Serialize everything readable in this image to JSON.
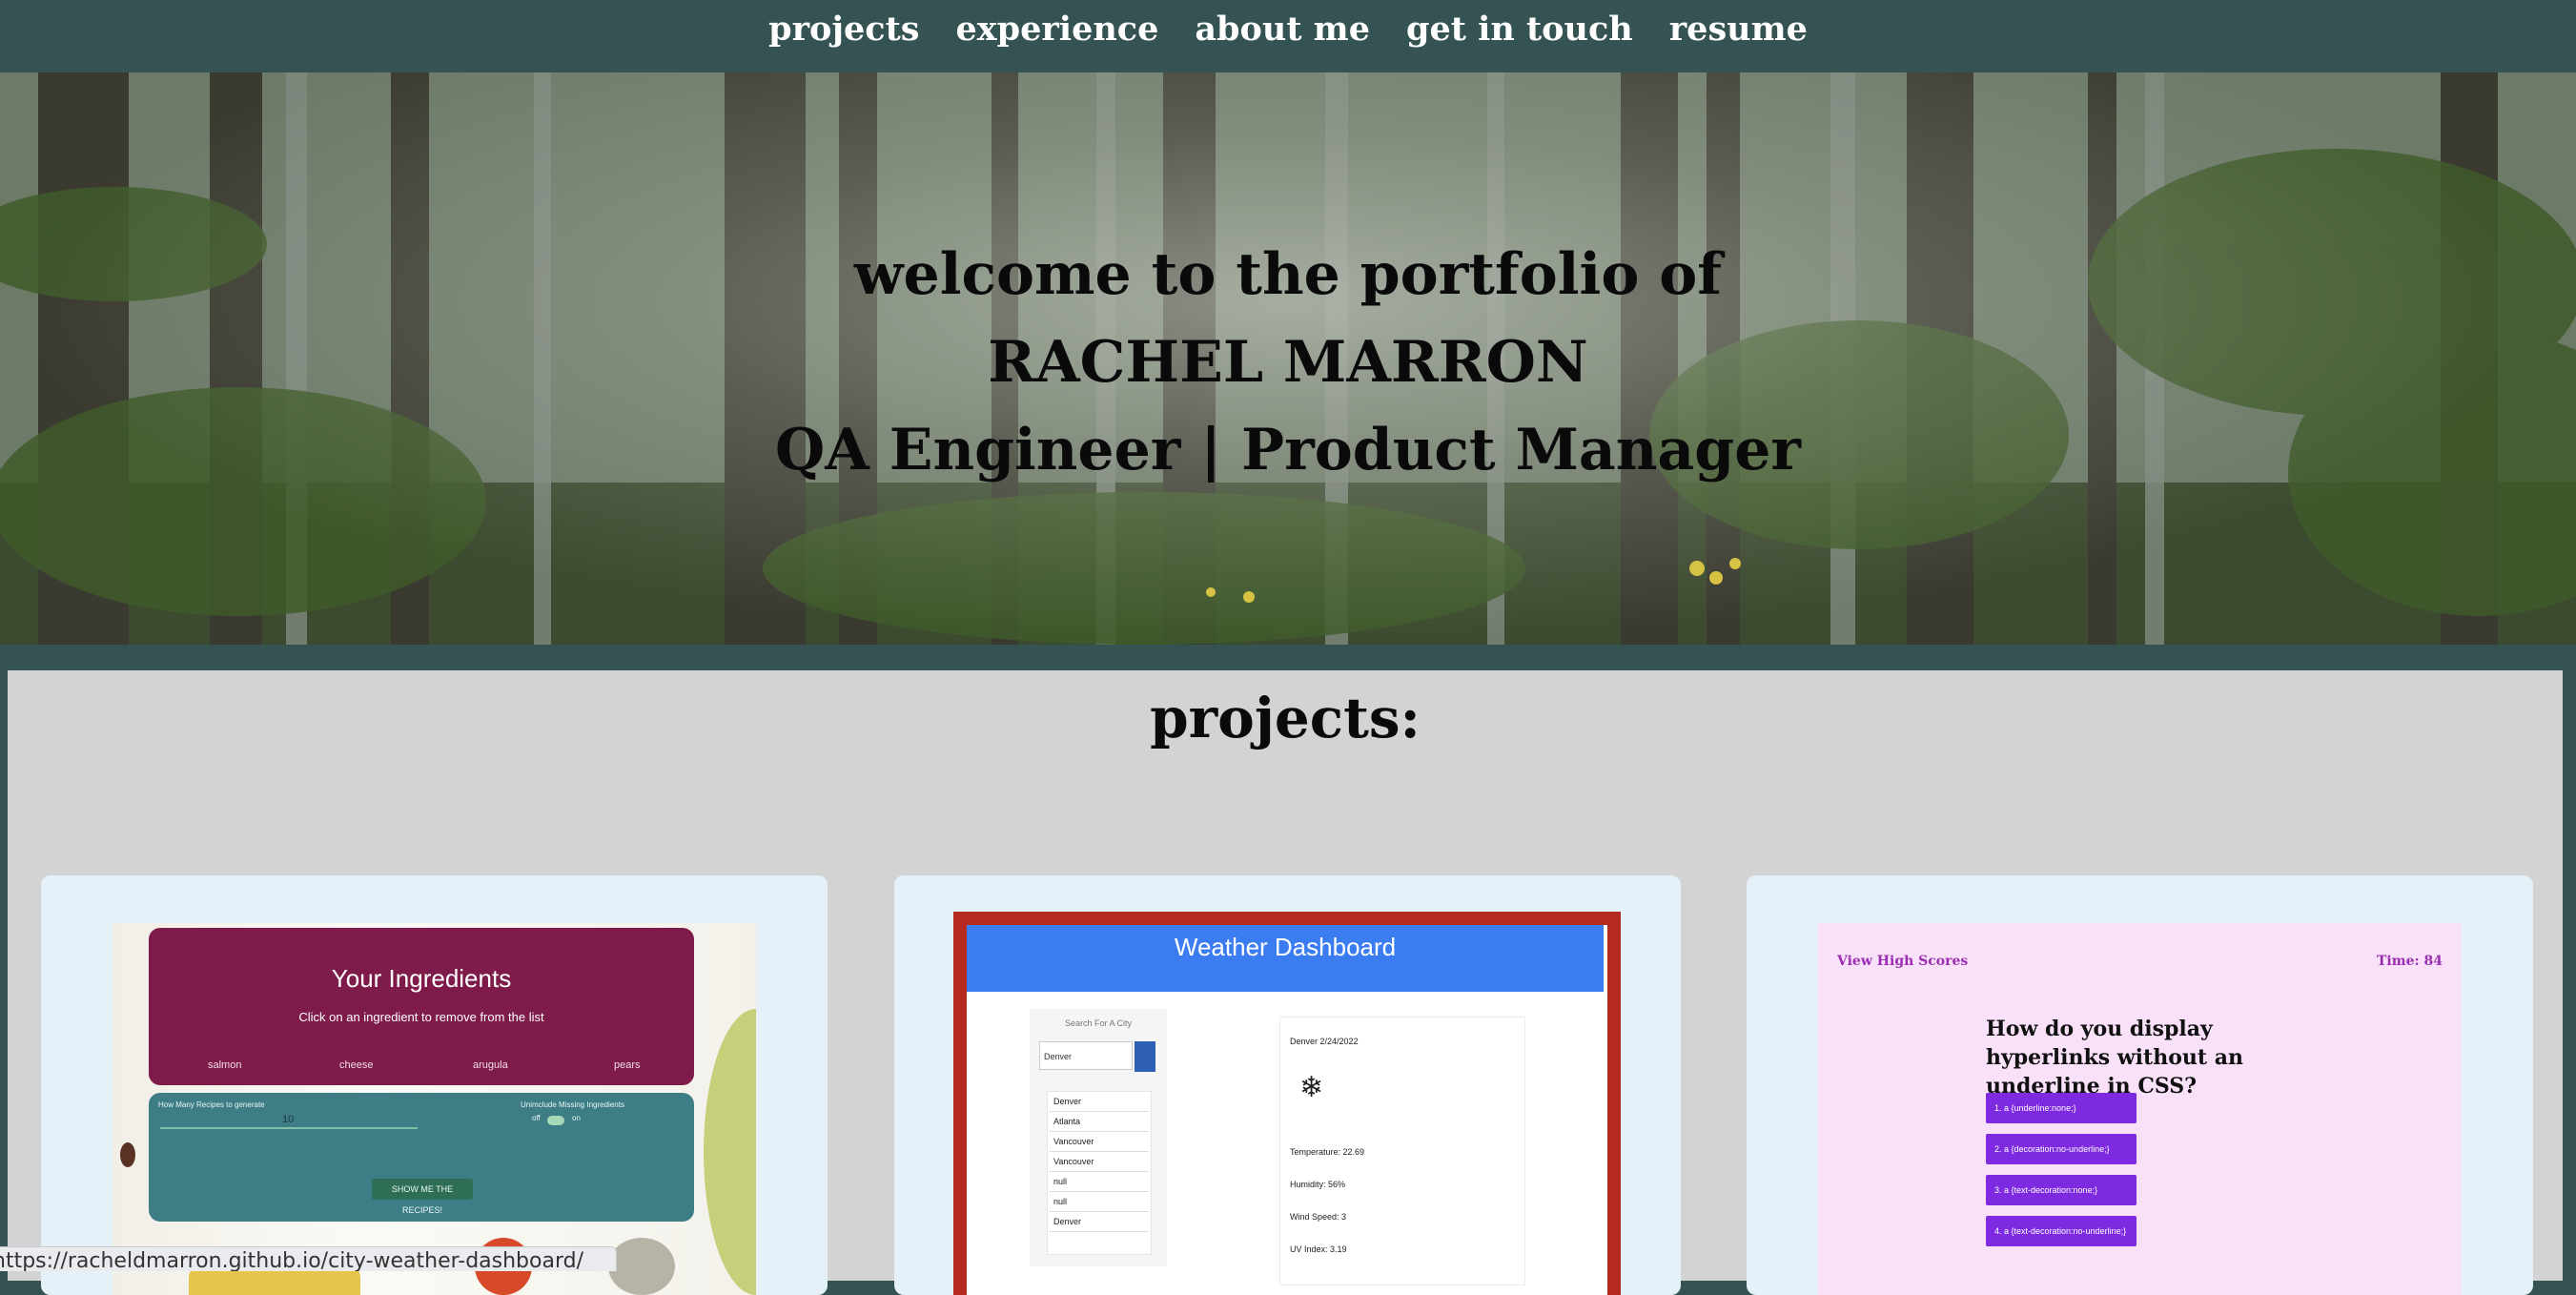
{
  "nav": {
    "items": [
      "projects",
      "experience",
      "about me",
      "get in touch",
      "resume"
    ]
  },
  "hero": {
    "line1": "welcome to the portfolio of",
    "line2": "RACHEL MARRON",
    "line3": "QA Engineer | Product Manager"
  },
  "projects": {
    "title": "projects:",
    "recipe": {
      "heading": "Your Ingredients",
      "subheading": "Click on an ingredient to remove from the list",
      "ingredients": [
        "salmon",
        "cheese",
        "arugula",
        "pears"
      ],
      "how_many_label": "How Many Recipes to generate",
      "how_many_value": "10",
      "missing_label": "Unimclude Missing Ingredients",
      "toggle_off": "off",
      "toggle_on": "on",
      "button": "SHOW ME THE RECIPES!"
    },
    "weather": {
      "header": "Weather Dashboard",
      "search_label": "Search For A City",
      "search_value": "Denver",
      "cities": [
        "Denver",
        "Atlanta",
        "Vancouver",
        "Vancouver",
        "null",
        "null",
        "Denver"
      ],
      "current_date": "Denver 2/24/2022",
      "temperature": "Temperature: 22.69",
      "humidity": "Humidity: 56%",
      "wind": "Wind Speed: 3",
      "uv": "UV Index: 3.19"
    },
    "quiz": {
      "high_scores": "View High Scores",
      "time": "Time: 84",
      "question": "How do you display hyperlinks without an underline in CSS?",
      "options": [
        "1. a {underline:none;}",
        "2. a {decoration:no-underline;}",
        "3. a {text-decoration:none;}",
        "4. a {text-decoration:no-underline;}"
      ]
    }
  },
  "status_bar": {
    "url": "https://racheldmarron.github.io/city-weather-dashboard/"
  },
  "colors": {
    "nav_bg": "#355353",
    "section_bg": "#d3d3d3",
    "card_bg": "#e5f1f9"
  }
}
